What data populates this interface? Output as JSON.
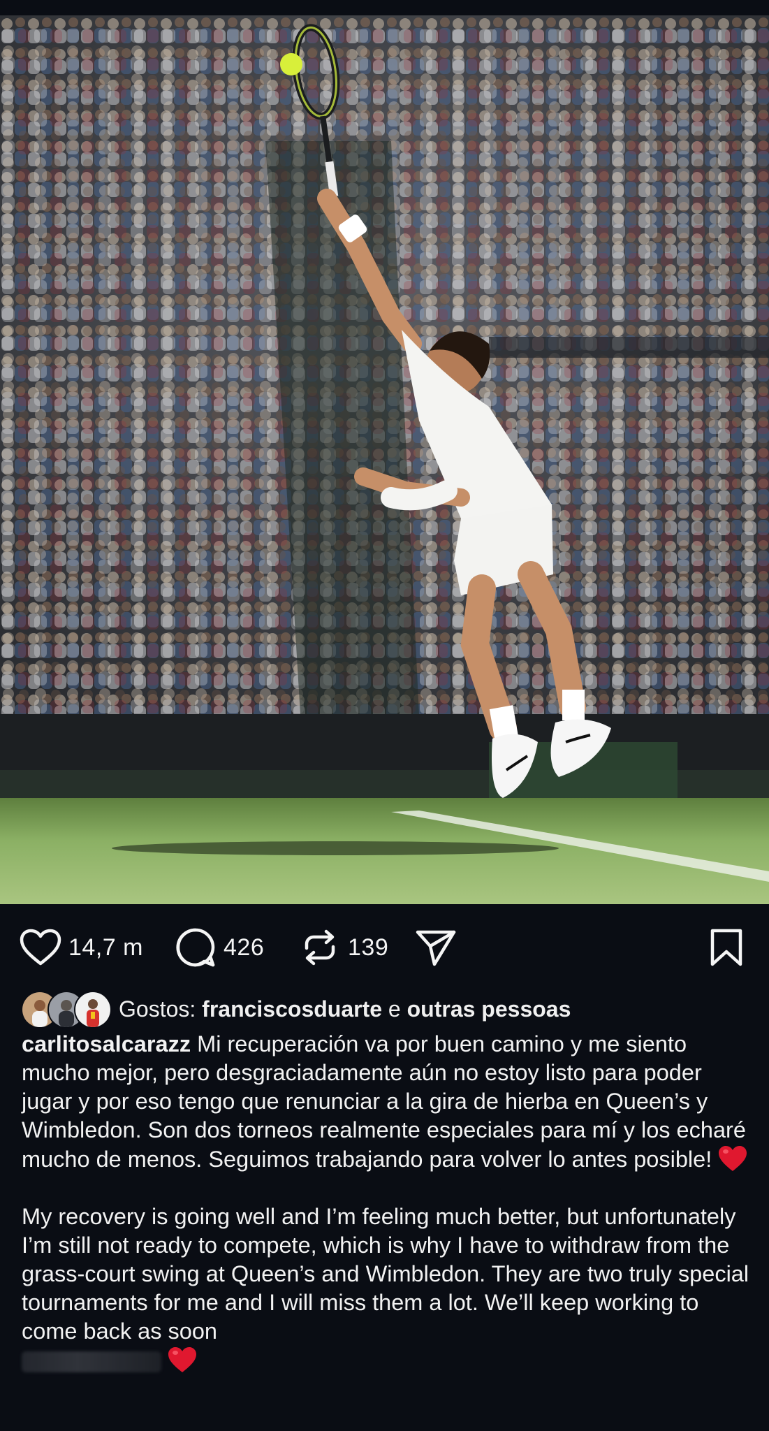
{
  "actions": {
    "likes": "14,7 m",
    "comments": "426",
    "reposts": "139",
    "icons": [
      "heart-icon",
      "comment-icon",
      "repost-icon",
      "share-icon",
      "bookmark-icon"
    ]
  },
  "likes_row": {
    "prefix": "Gostos: ",
    "liker": "francisco­sduarte",
    "connector": " e ",
    "others": "outras pessoas"
  },
  "caption": {
    "username": "carlitosalcarazz",
    "spanish": "Mi recuperación va por buen camino y me siento mucho mejor, pero desgraciadamente aún no estoy listo para poder jugar y por eso tengo que renunciar a la gira de hierba en Queen’s y Wimbledon. Son dos torneos realmente especiales para mí y los echaré mucho de menos. Seguimos trabajando para volver lo antes posible!",
    "english": "My recovery is going well and I’m feeling much better, but unfortunately I’m still not ready to compete, which is why I have to withdraw from the grass-court swing at Queen’s and Wimbledon. They are two truly special tournaments for me and I will miss them a lot. We’ll keep working to come back as soon"
  },
  "colors": {
    "background": "#0a0d14",
    "text": "#f2f2f2",
    "heart_emoji": "#e0182f",
    "grass": "#7fa85a"
  }
}
